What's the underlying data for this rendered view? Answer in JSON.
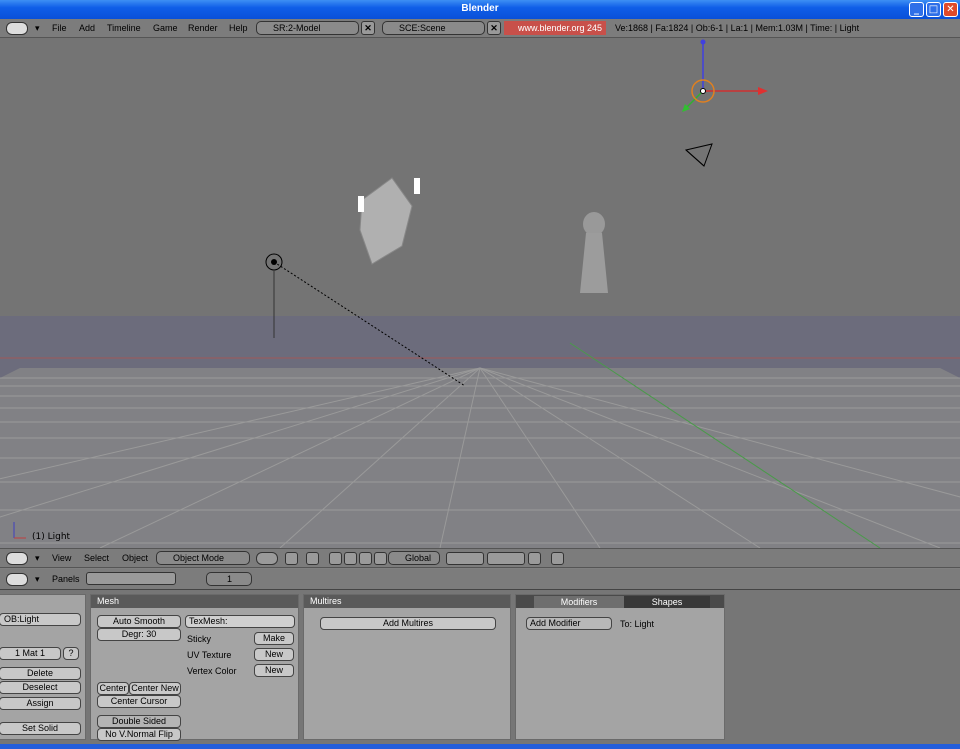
{
  "window": {
    "title": "Blender"
  },
  "topbar": {
    "menus": [
      "File",
      "Add",
      "Timeline",
      "Game",
      "Render",
      "Help"
    ],
    "screen": "SR:2-Model",
    "scene": "SCE:Scene",
    "link": "www.blender.org 245",
    "stats": "Ve:1868 | Fa:1824 | Ob:6-1 | La:1  | Mem:1.03M  | Time: | Light"
  },
  "viewport": {
    "object_label": "(1) Light"
  },
  "view_header": {
    "menus": [
      "View",
      "Select",
      "Object"
    ],
    "mode": "Object Mode",
    "orientation": "Global"
  },
  "buttons_header": {
    "panels_label": "Panels",
    "frame": "1"
  },
  "link_panel": {
    "ob_name": "OB:Light",
    "mat": "1 Mat 1",
    "mat_q": "?",
    "delete": "Delete",
    "deselect": "Deselect",
    "assign": "Assign",
    "set_solid": "Set Solid"
  },
  "mesh_panel": {
    "title": "Mesh",
    "auto_smooth": "Auto Smooth",
    "degr": "Degr: 30",
    "texmesh": "TexMesh:",
    "sticky": "Sticky",
    "make": "Make",
    "uv_texture": "UV Texture",
    "new": "New",
    "vertex_color": "Vertex Color",
    "center": "Center",
    "center_new": "Center New",
    "center_cursor": "Center Cursor",
    "double_sided": "Double Sided",
    "no_vnormal_flip": "No V.Normal Flip"
  },
  "multires_panel": {
    "title": "Multires",
    "add": "Add Multires"
  },
  "modifiers_panel": {
    "tab_modifiers": "Modifiers",
    "tab_shapes": "Shapes",
    "add_modifier": "Add Modifier",
    "to": "To: Light"
  },
  "colors": {
    "titlebar": "#0f5ee8",
    "link_bg": "#c8504a",
    "panel_bg": "#a4a4a4",
    "grid": "#9a9a9a"
  }
}
